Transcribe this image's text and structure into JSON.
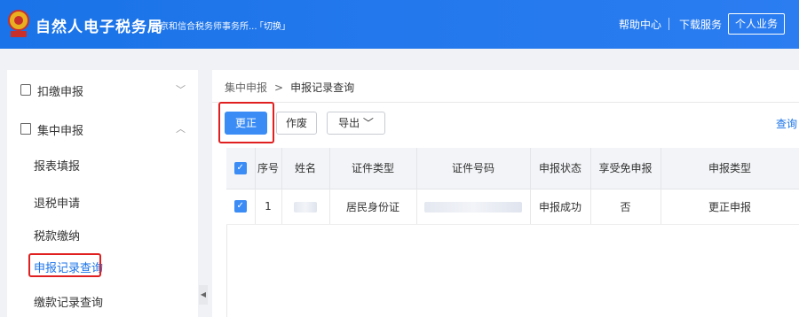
{
  "header": {
    "app_title": "自然人电子税务局",
    "org_name": "北京和信合税务师事务所...",
    "switch_label": "「切换」",
    "help_label": "帮助中心",
    "download_label": "下载服务",
    "personal_label": "个人业务",
    "brand_color": "#1a73e8"
  },
  "sidebar": {
    "groups": [
      {
        "label": "扣缴申报",
        "icon": "form-icon",
        "chevron": "﹀"
      },
      {
        "label": "集中申报",
        "icon": "document-icon",
        "chevron": "︿"
      }
    ],
    "sub_items": [
      {
        "label": "报表填报"
      },
      {
        "label": "退税申请"
      },
      {
        "label": "税款缴纳"
      },
      {
        "label": "申报记录查询"
      },
      {
        "label": "缴款记录查询"
      }
    ],
    "collapse_glyph": "◀"
  },
  "breadcrumb": {
    "root": "集中申报",
    "separator": ">",
    "current": "申报记录查询"
  },
  "toolbar": {
    "correct_label": "更正",
    "void_label": "作废",
    "export_label": "导出 ﹀",
    "query_label": "查询"
  },
  "table": {
    "headers": [
      "序号",
      "姓名",
      "证件类型",
      "证件号码",
      "申报状态",
      "享受免申报",
      "申报类型"
    ],
    "rows": [
      {
        "index": "1",
        "id_type": "居民身份证",
        "status": "申报成功",
        "exempt": "否",
        "type": "更正申报"
      }
    ]
  },
  "accent_red": "#e02020"
}
